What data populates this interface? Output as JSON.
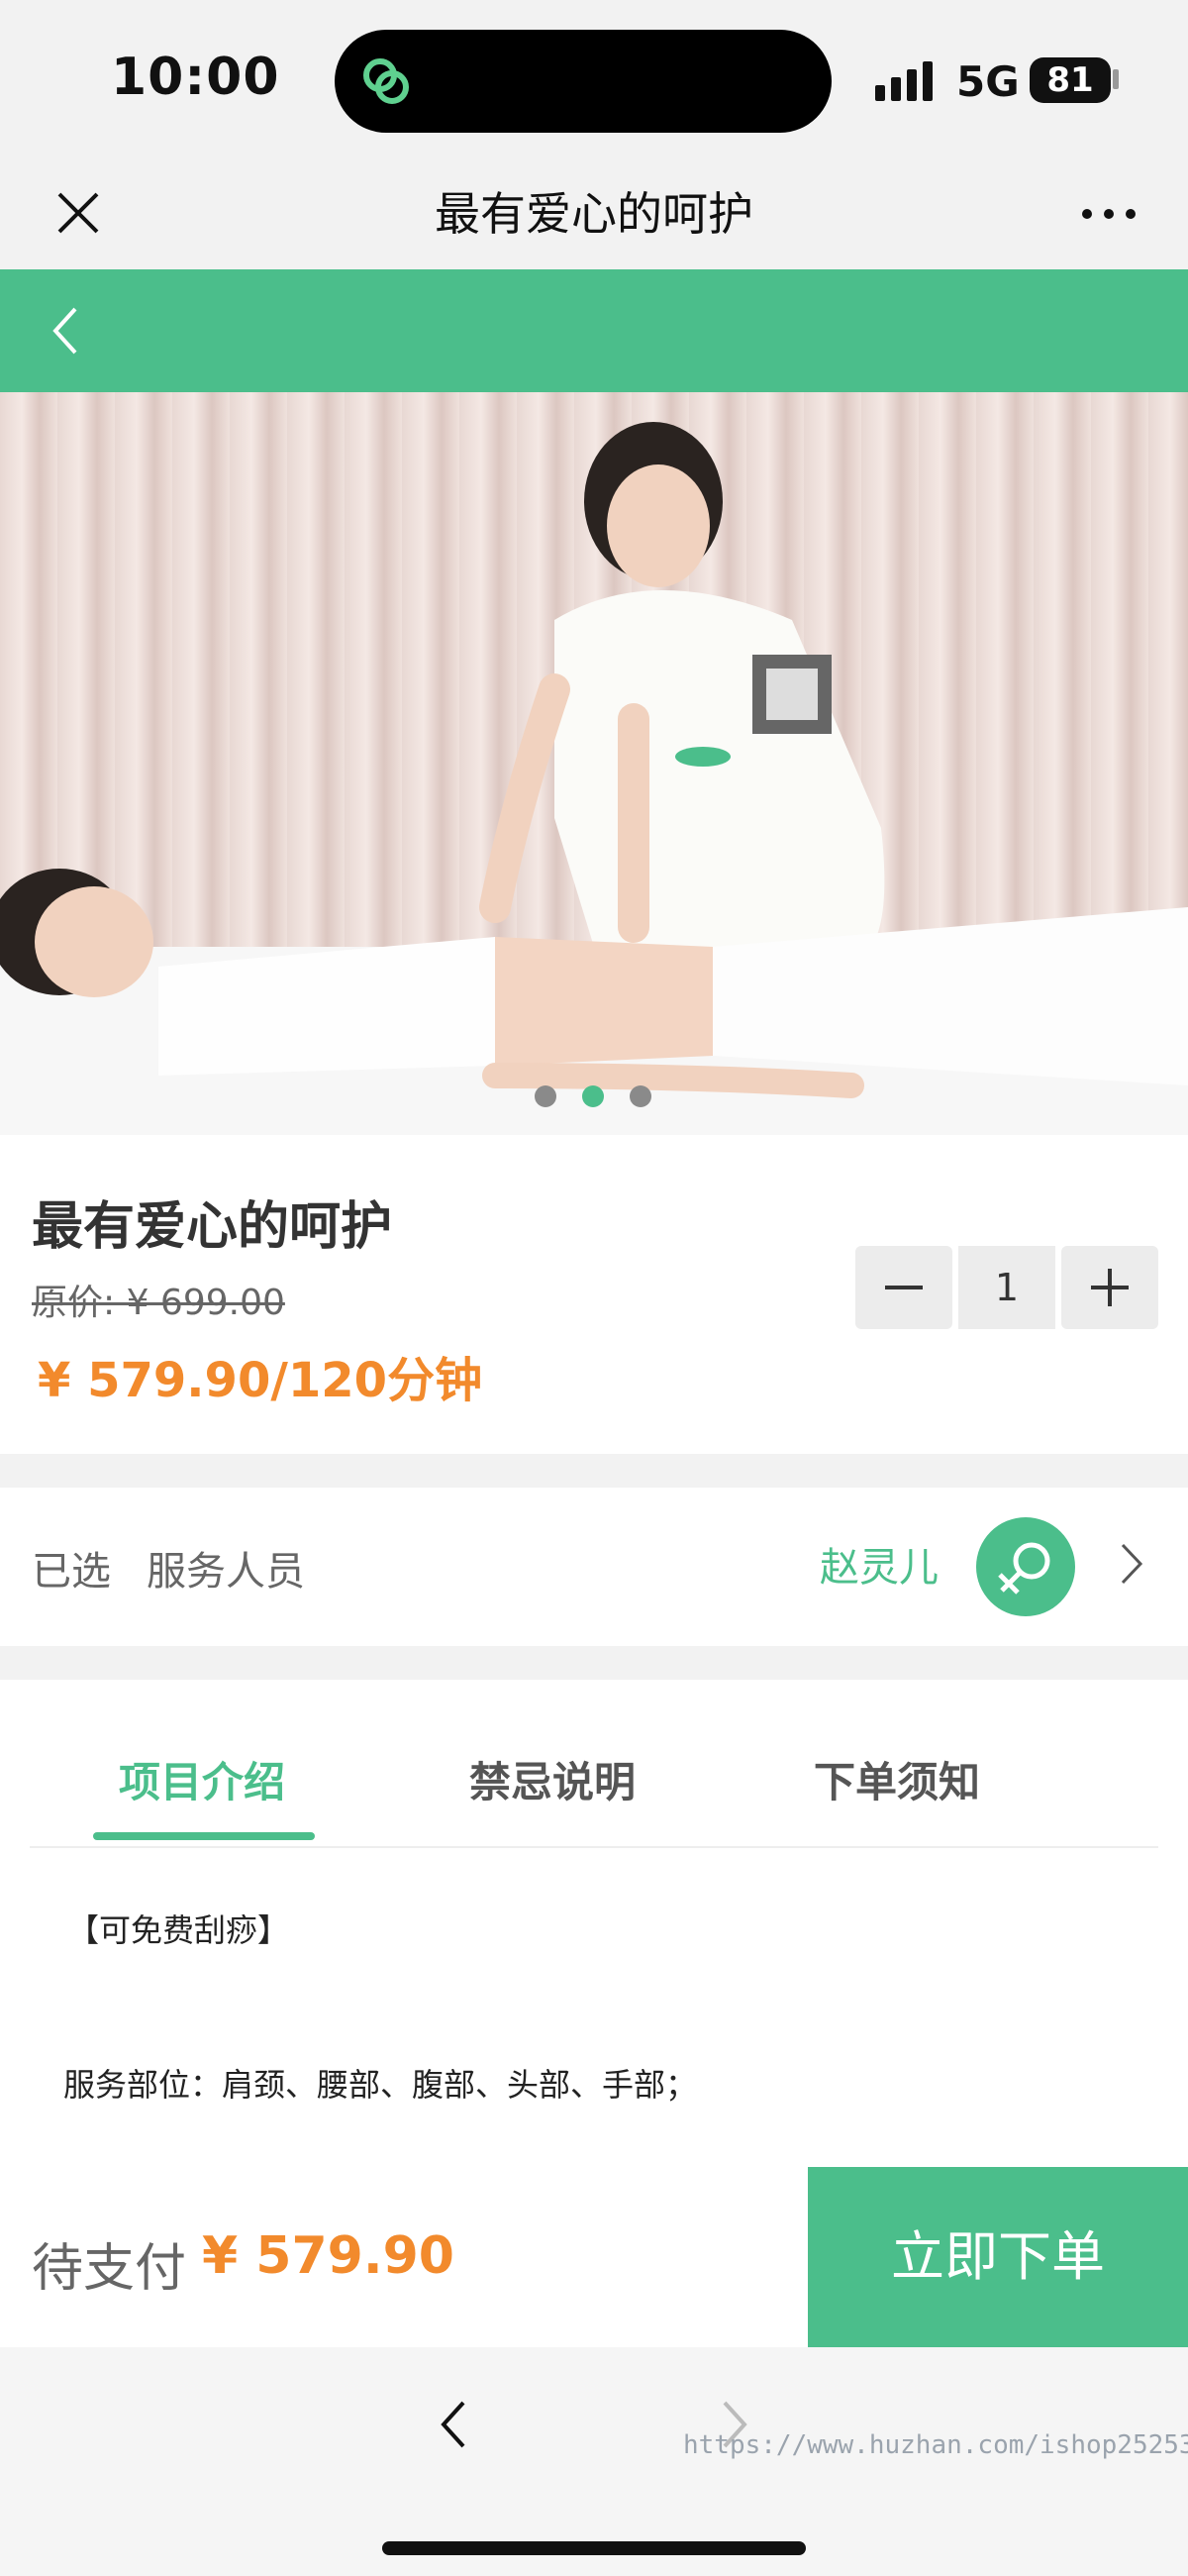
{
  "status_bar": {
    "time": "10:00",
    "network": "5G",
    "battery": "81"
  },
  "wechat_nav": {
    "title": "最有爱心的呵护",
    "icons": [
      "close-icon",
      "more-icon"
    ]
  },
  "header": {
    "back_icon": "chevron-left-icon",
    "accent_color": "#4bbe8b"
  },
  "banner": {
    "dot_count": 3,
    "active_dot": 1
  },
  "product": {
    "title": "最有爱心的呵护",
    "original_price": "原价: ¥ 699.00",
    "price": "¥ 579.90/120分钟",
    "quantity": "1",
    "price_color": "#f28a2c"
  },
  "selection": {
    "label": "已选",
    "sub": "服务人员",
    "name": "赵灵儿",
    "avatar_icon": "female-symbol-icon"
  },
  "tabs": [
    {
      "label": "项目介绍",
      "active": true
    },
    {
      "label": "禁忌说明",
      "active": false
    },
    {
      "label": "下单须知",
      "active": false
    }
  ],
  "content": {
    "line1": "【可免费刮痧】",
    "line2": "服务部位：肩颈、腰部、腹部、头部、手部；"
  },
  "action": {
    "pay_label": "待支付",
    "pay_amount": "¥ 579.90",
    "order_button": "立即下单"
  },
  "browser": {
    "watermark": "https://www.huzhan.com/ishop25253"
  }
}
